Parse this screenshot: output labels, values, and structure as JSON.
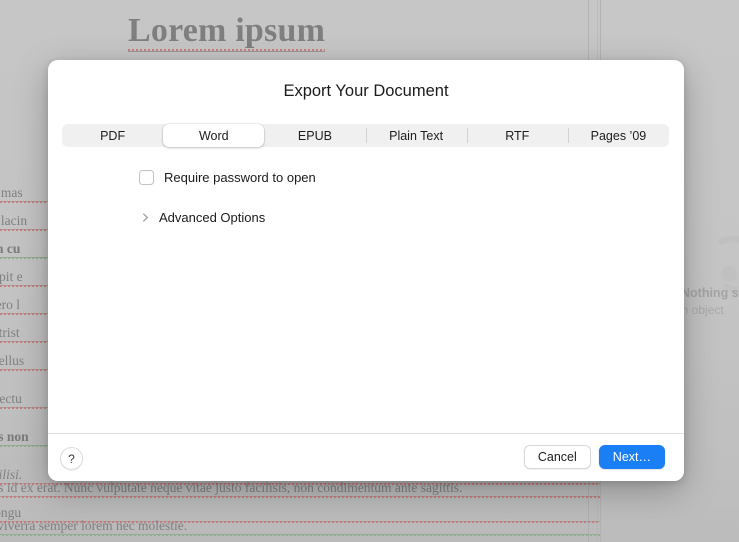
{
  "background": {
    "document_title": "Lorem ipsum",
    "body_lines": [
      "eque  mas",
      ", nec lacin",
      "psum  cu",
      "suscipit e",
      "c libero l",
      "felis trist",
      "ulis tellus",
      "uris lectu",
      "cenas non",
      "a facilisi.",
      "an congu"
    ],
    "bottom_lines": [
      "ris id ex erat. Nunc vulputate neque vitae justo facilisis, non condimentum ante sagittis.",
      "i viverra semper lorem nec molestie."
    ],
    "inspector": {
      "empty_title": "Nothing s",
      "empty_subtitle": "an object",
      "placeholder_icon": "object-placeholder-icon"
    }
  },
  "sheet": {
    "title": "Export Your Document",
    "format_tabs": [
      {
        "label": "PDF",
        "selected": false
      },
      {
        "label": "Word",
        "selected": true
      },
      {
        "label": "EPUB",
        "selected": false
      },
      {
        "label": "Plain Text",
        "selected": false
      },
      {
        "label": "RTF",
        "selected": false
      },
      {
        "label": "Pages ’09",
        "selected": false
      }
    ],
    "options": {
      "require_password_label": "Require password to open",
      "require_password_checked": false,
      "advanced_options_label": "Advanced Options",
      "advanced_options_expanded": false
    },
    "footer": {
      "help_label": "?",
      "cancel_label": "Cancel",
      "next_label": "Next…"
    }
  },
  "colors": {
    "accent_blue": "#1a7ef5",
    "sheet_background": "#ffffff",
    "segmented_track": "#f0f0f0",
    "window_background": "#c8c8c8",
    "spellcheck_red": "#cf6a6a",
    "grammar_green": "#7ab07a"
  }
}
